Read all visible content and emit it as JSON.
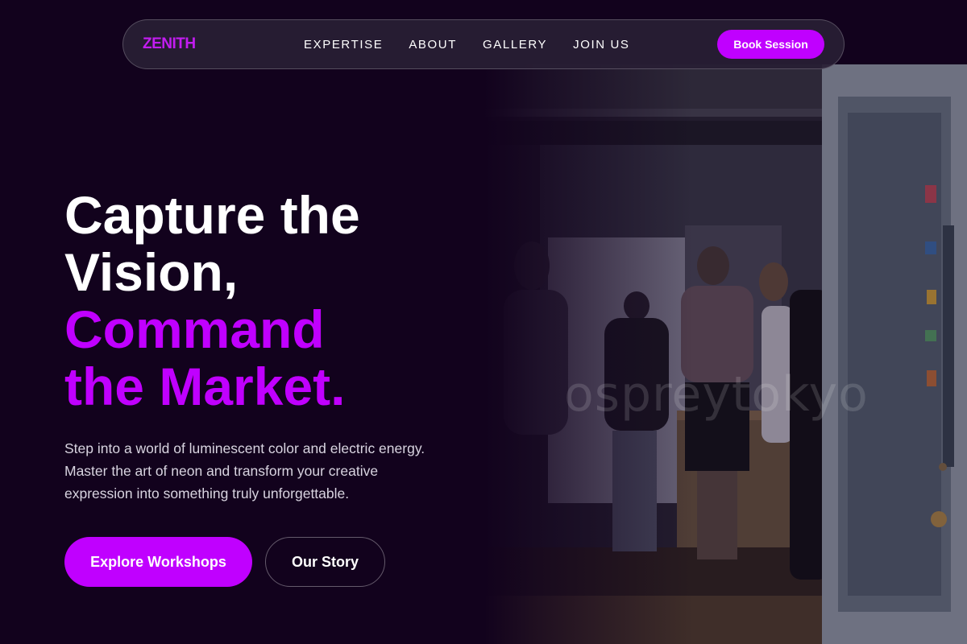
{
  "brand": {
    "logo_text": "ZENITH",
    "accent_color": "#c000ff",
    "background_color": "#12021d"
  },
  "nav": {
    "links": [
      "EXPERTISE",
      "ABOUT",
      "GALLERY",
      "JOIN US"
    ],
    "cta_label": "Book Session"
  },
  "hero": {
    "headline_lines": [
      "Capture the",
      "Vision,",
      "Command",
      "the Market."
    ],
    "description": "Step into a world of luminescent color and electric energy. Master the art of neon and transform your creative expression into something truly unforgettable.",
    "primary_button": "Explore Workshops",
    "secondary_button": "Our Story",
    "image_watermark": "ospreytokyo"
  }
}
